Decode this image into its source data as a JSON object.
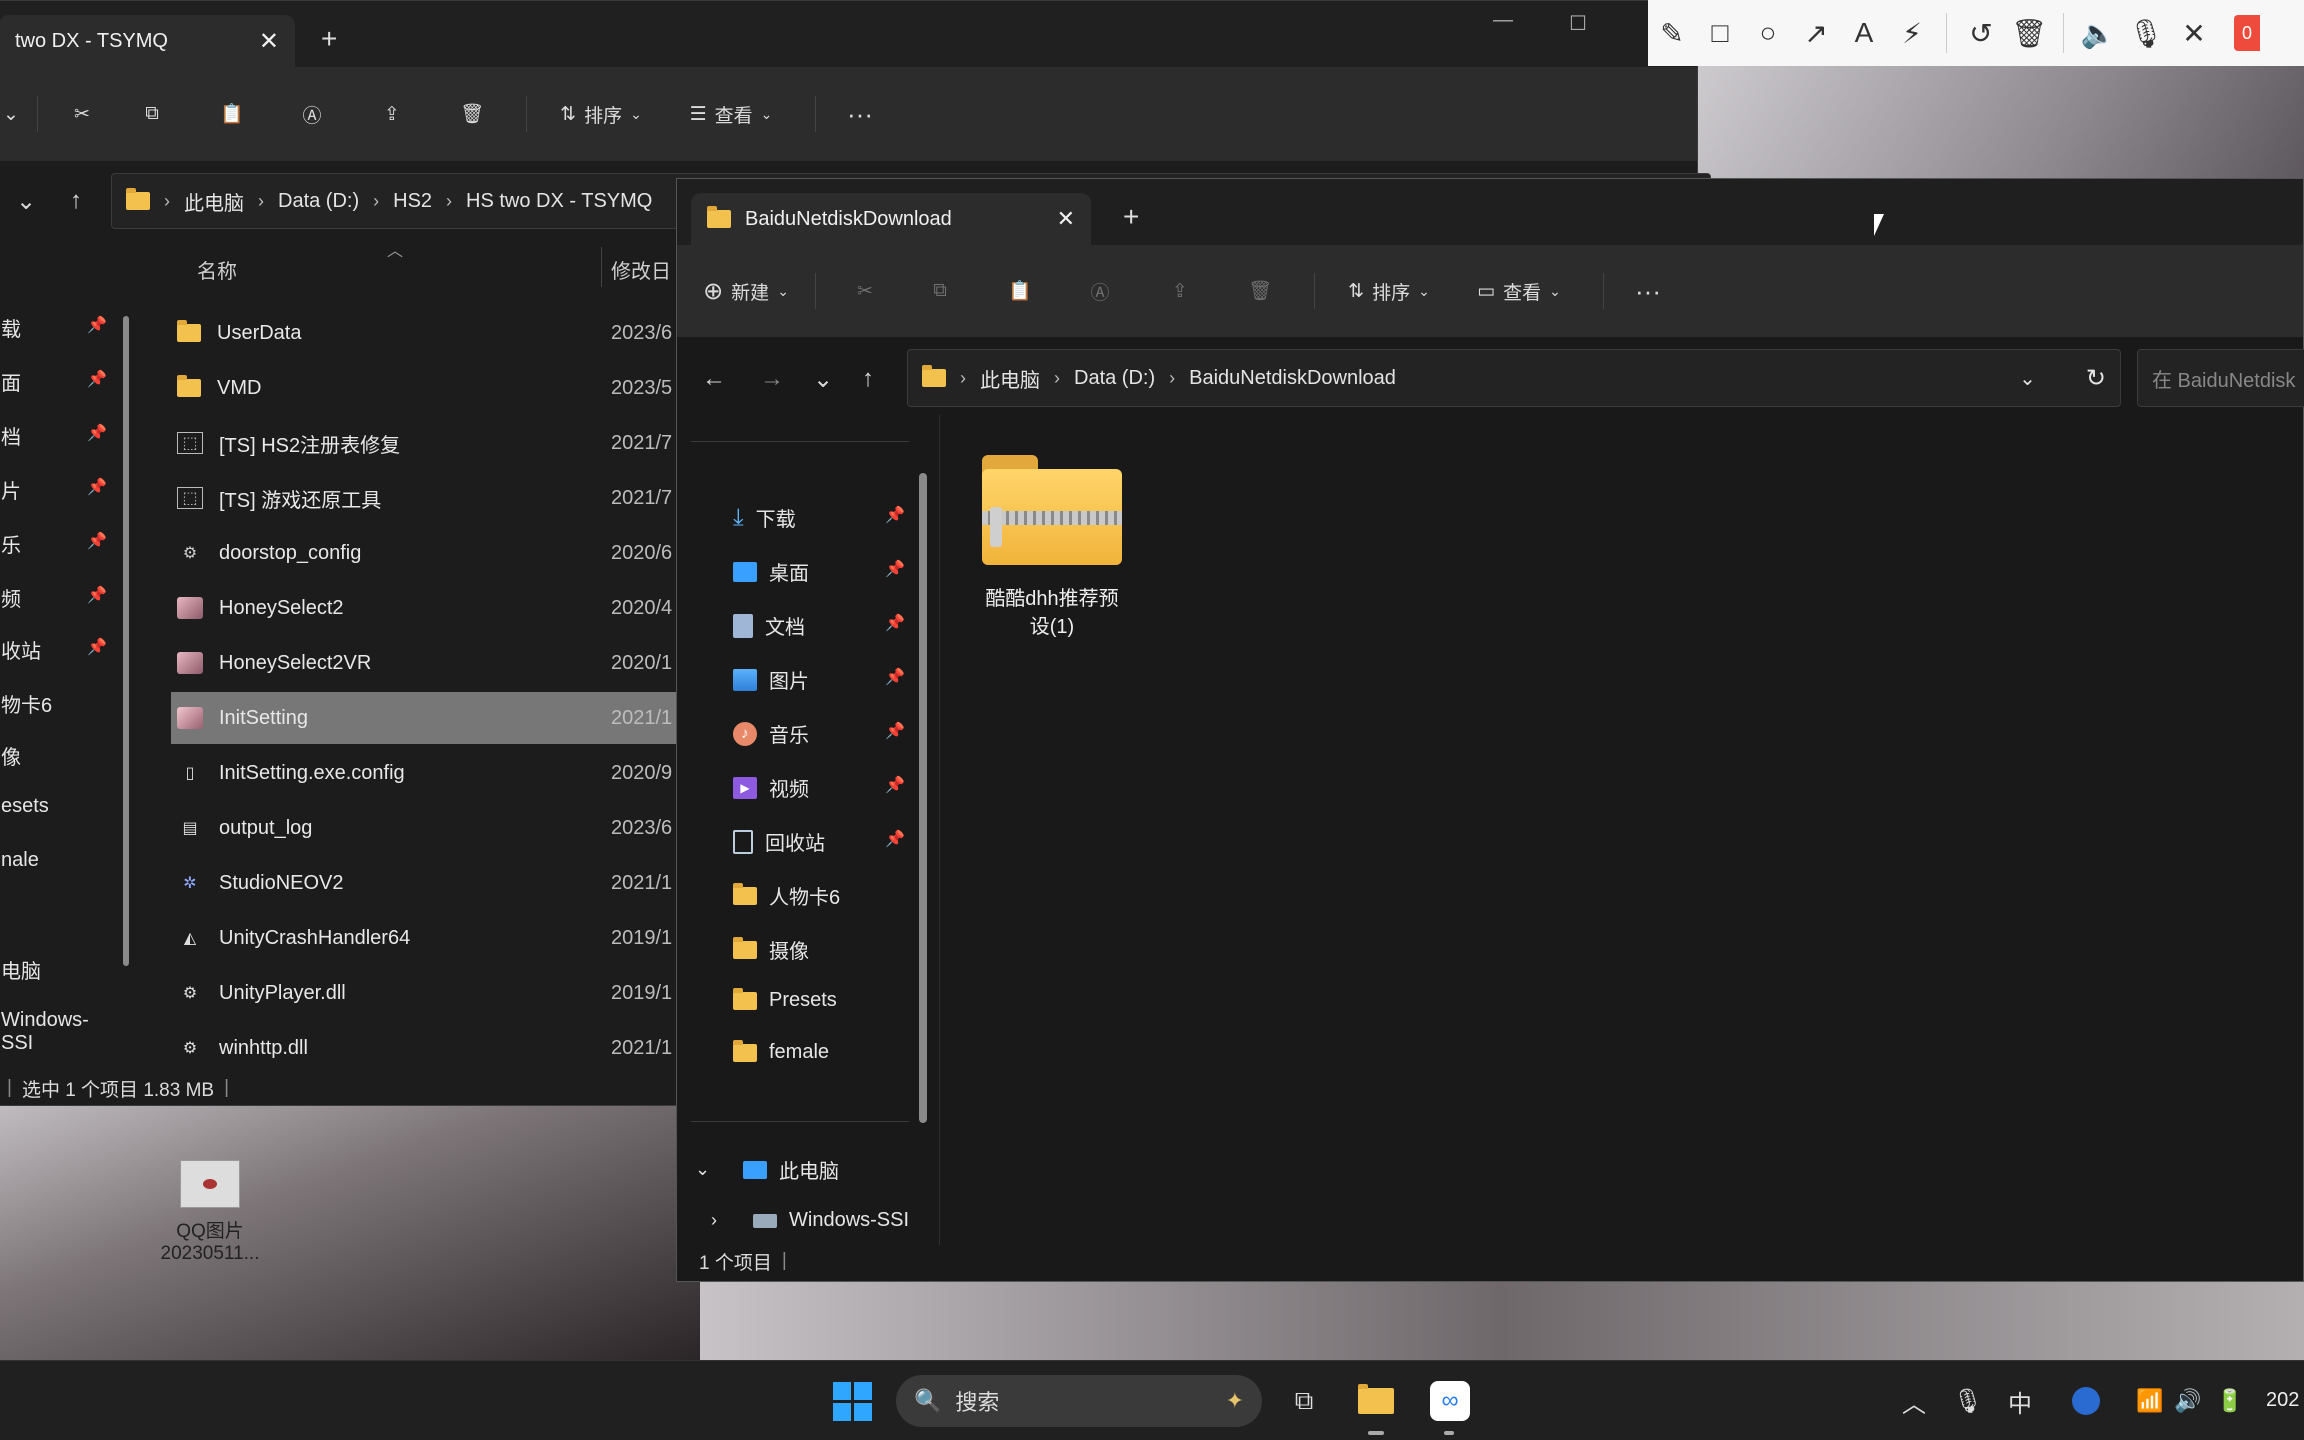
{
  "back_window": {
    "tab_title": "two DX - TSYMQ",
    "toolbar": {
      "sort": "排序",
      "view": "查看"
    },
    "address": [
      "此电脑",
      "Data (D:)",
      "HS2",
      "HS two DX - TSYMQ"
    ],
    "columns": {
      "name": "名称",
      "date": "修改日"
    },
    "sidebar": [
      "载",
      "面",
      "档",
      "片",
      "乐",
      "频",
      "收站",
      "物卡6",
      "像",
      "esets",
      "nale",
      "电脑",
      "Windows-SSI"
    ],
    "files": [
      {
        "name": "UserData",
        "date": "2023/6",
        "icon": "folder-icon"
      },
      {
        "name": "VMD",
        "date": "2023/5",
        "icon": "folder-icon"
      },
      {
        "name": "[TS] HS2注册表修复",
        "date": "2021/7",
        "icon": "shortcut-icon"
      },
      {
        "name": "[TS] 游戏还原工具",
        "date": "2021/7",
        "icon": "shortcut-icon"
      },
      {
        "name": "doorstop_config",
        "date": "2020/6",
        "icon": "config-file-icon"
      },
      {
        "name": "HoneySelect2",
        "date": "2020/4",
        "icon": "app-icon"
      },
      {
        "name": "HoneySelect2VR",
        "date": "2020/1",
        "icon": "app-icon"
      },
      {
        "name": "InitSetting",
        "date": "2021/1",
        "icon": "app-icon"
      },
      {
        "name": "InitSetting.exe.config",
        "date": "2020/9",
        "icon": "file-icon"
      },
      {
        "name": "output_log",
        "date": "2023/6",
        "icon": "text-file-icon"
      },
      {
        "name": "StudioNEOV2",
        "date": "2021/1",
        "icon": "studio-app-icon"
      },
      {
        "name": "UnityCrashHandler64",
        "date": "2019/1",
        "icon": "unity-icon"
      },
      {
        "name": "UnityPlayer.dll",
        "date": "2019/1",
        "icon": "dll-icon"
      },
      {
        "name": "winhttp.dll",
        "date": "2021/1",
        "icon": "dll-icon"
      }
    ],
    "selected_index": 7,
    "status": "选中 1 个项目  1.83 MB"
  },
  "front_window": {
    "tab_title": "BaiduNetdiskDownload",
    "toolbar": {
      "new": "新建",
      "sort": "排序",
      "view": "查看"
    },
    "address": [
      "此电脑",
      "Data (D:)",
      "BaiduNetdiskDownload"
    ],
    "search_placeholder": "在 BaiduNetdisk",
    "sidebar": [
      {
        "label": "下载",
        "icon": "download-icon",
        "pinned": true
      },
      {
        "label": "桌面",
        "icon": "desktop-icon",
        "pinned": true
      },
      {
        "label": "文档",
        "icon": "document-icon",
        "pinned": true
      },
      {
        "label": "图片",
        "icon": "pictures-icon",
        "pinned": true
      },
      {
        "label": "音乐",
        "icon": "music-icon",
        "pinned": true
      },
      {
        "label": "视频",
        "icon": "video-icon",
        "pinned": true
      },
      {
        "label": "回收站",
        "icon": "recycle-bin-icon",
        "pinned": true
      },
      {
        "label": "人物卡6",
        "icon": "folder-icon",
        "pinned": false
      },
      {
        "label": "摄像",
        "icon": "folder-icon",
        "pinned": false
      },
      {
        "label": "Presets",
        "icon": "folder-icon",
        "pinned": false
      },
      {
        "label": "female",
        "icon": "folder-icon",
        "pinned": false
      }
    ],
    "tree": {
      "this_pc": "此电脑",
      "drive": "Windows-SSI"
    },
    "item": {
      "name": "酷酷dhh推荐预设(1)",
      "icon": "zip-folder-icon"
    },
    "status": "1 个项目"
  },
  "desktop": {
    "icon_label_1": "QQ图片",
    "icon_label_2": "20230511..."
  },
  "taskbar": {
    "search": "搜索",
    "ime": "中",
    "clock": "202"
  },
  "drawbar": {
    "badge": "0"
  }
}
